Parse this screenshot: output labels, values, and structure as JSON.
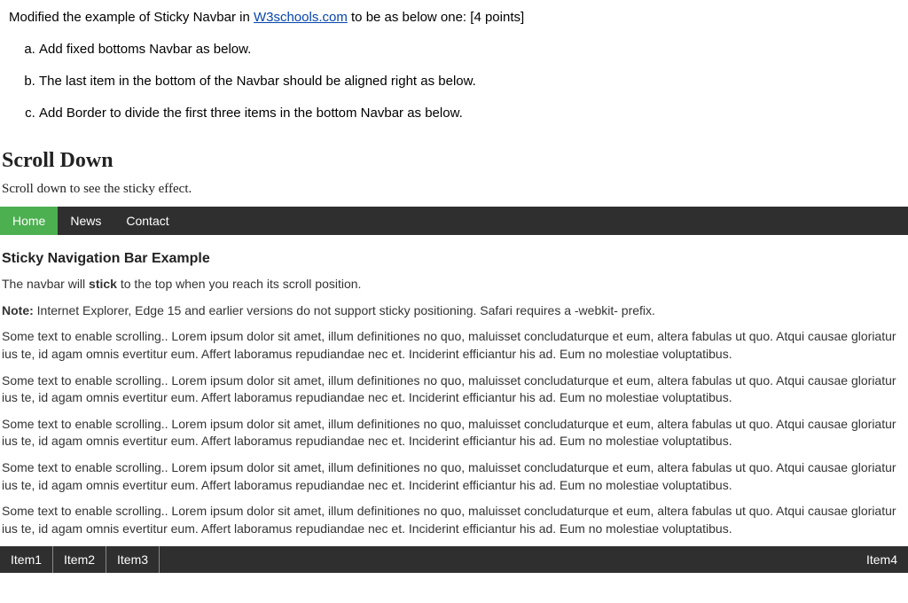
{
  "question": {
    "prefix": "Modified the example of Sticky Navbar in ",
    "link_text": "W3schools.com",
    "link_href": "#",
    "suffix": " to be as below one: ",
    "points": "[4 points]",
    "items": [
      "Add fixed bottoms Navbar as below.",
      "The last item in the bottom of the Navbar should be aligned right as below.",
      "Add Border to divide the first three items in the bottom Navbar as below."
    ]
  },
  "demo": {
    "heading": "Scroll Down",
    "sub": "Scroll down to see the sticky effect.",
    "topnav": {
      "home": "Home",
      "news": "News",
      "contact": "Contact"
    },
    "example_title": "Sticky Navigation Bar Example",
    "stick_line_a": "The navbar will ",
    "stick_bold": "stick",
    "stick_line_b": " to the top when you reach its scroll position.",
    "note_bold": "Note:",
    "note_rest": " Internet Explorer, Edge 15 and earlier versions do not support sticky positioning. Safari requires a -webkit- prefix.",
    "lorem": "Some text to enable scrolling.. Lorem ipsum dolor sit amet, illum definitiones no quo, maluisset concludaturque et eum, altera fabulas ut quo. Atqui causae gloriatur ius te, id agam omnis evertitur eum. Affert laboramus repudiandae nec et. Inciderint efficiantur his ad. Eum no molestiae voluptatibus.",
    "bottomnav": {
      "i1": "Item1",
      "i2": "Item2",
      "i3": "Item3",
      "i4": "Item4"
    }
  }
}
